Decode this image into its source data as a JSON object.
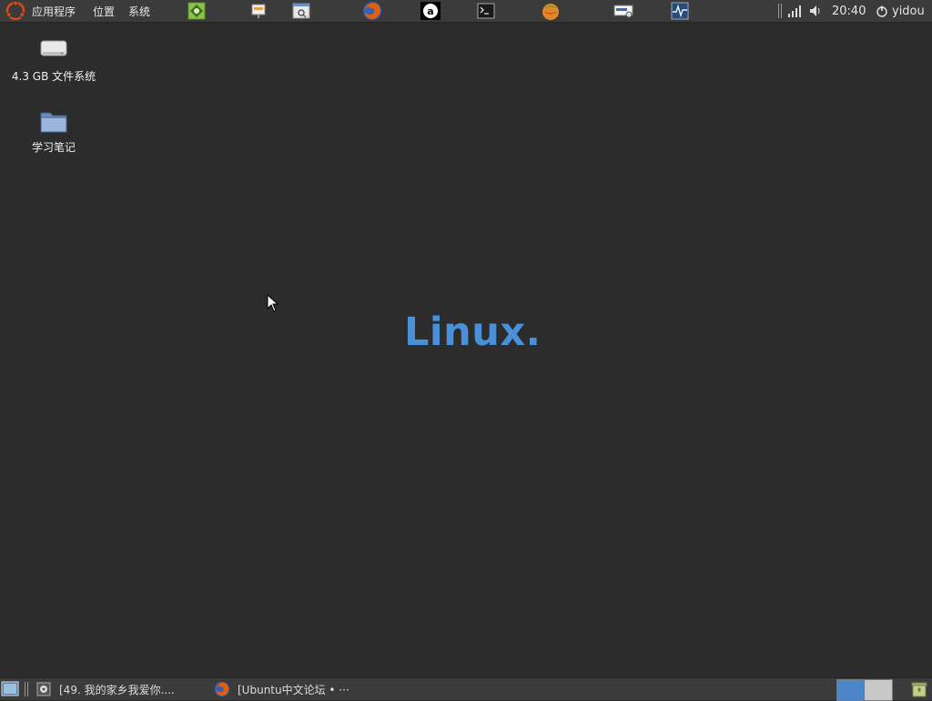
{
  "top_panel": {
    "menus": [
      "应用程序",
      "位置",
      "系统"
    ],
    "launchers": [
      "app-launcher-green-icon",
      "presentation-icon",
      "window-search-icon",
      "firefox-icon",
      "amarok-icon",
      "terminal-icon",
      "orange-ball-icon",
      "network-card-icon",
      "system-monitor-icon"
    ],
    "clock": "20:40",
    "user": "yidou"
  },
  "desktop": {
    "icons": [
      {
        "label": "4.3 GB 文件系统",
        "icon": "drive-icon"
      },
      {
        "label": "学习笔记",
        "icon": "folder-icon"
      }
    ],
    "wallpaper_text": "Linux."
  },
  "bottom_panel": {
    "tasks": [
      {
        "label": "[49. 我的家乡我爱你....",
        "icon": "media-player-icon"
      },
      {
        "label": "[Ubuntu中文论坛 • ···",
        "icon": "firefox-icon"
      }
    ]
  },
  "colors": {
    "desktop_bg": "#2c2c2c",
    "panel_bg": "#3b3b3b",
    "wallpaper_text": "#4a90d9",
    "workspace_active": "#4a86c8",
    "workspace_inactive": "#c8c8c8"
  }
}
